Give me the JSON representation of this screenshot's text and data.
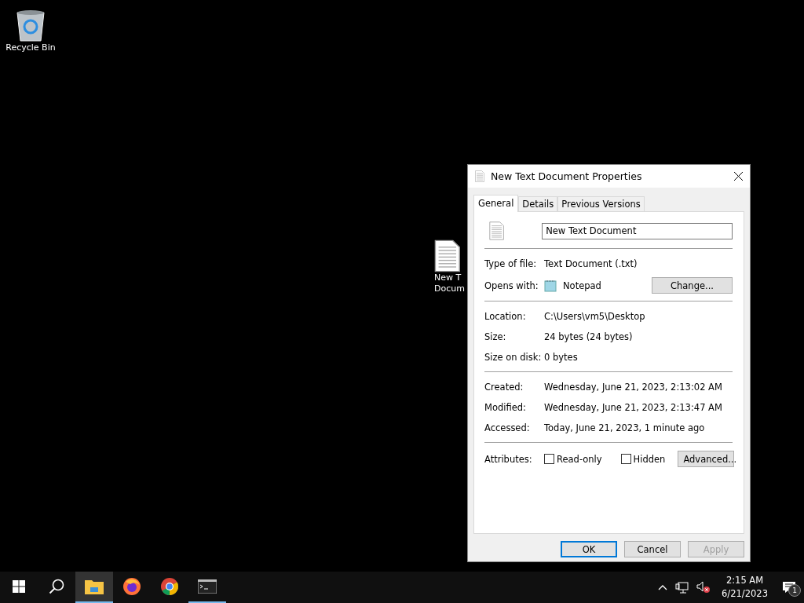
{
  "desktop_icons": [
    {
      "kind": "recycle-bin",
      "label_lines": [
        "Recycle Bin"
      ]
    },
    {
      "kind": "text-file",
      "label_lines": [
        "New T",
        "Docum"
      ]
    }
  ],
  "dialog": {
    "title": "New Text Document Properties",
    "tabs": [
      {
        "label": "General",
        "selected": true
      },
      {
        "label": "Details",
        "selected": false
      },
      {
        "label": "Previous Versions",
        "selected": false
      }
    ],
    "file_name": "New Text Document",
    "sections": [
      [
        {
          "label": "Type of file:",
          "value": "Text Document (.txt)"
        },
        {
          "label": "Opens with:",
          "value": "Notepad",
          "app_icon": true,
          "button": "Change..."
        }
      ],
      [
        {
          "label": "Location:",
          "value": "C:\\Users\\vm5\\Desktop"
        },
        {
          "label": "Size:",
          "value": "24 bytes (24 bytes)"
        },
        {
          "label": "Size on disk:",
          "value": "0 bytes"
        }
      ],
      [
        {
          "label": "Created:",
          "value": "Wednesday, June 21, 2023, 2:13:02 AM"
        },
        {
          "label": "Modified:",
          "value": "Wednesday, June 21, 2023, 2:13:47 AM"
        },
        {
          "label": "Accessed:",
          "value": "Today, June 21, 2023, 1 minute ago"
        }
      ]
    ],
    "attributes": {
      "label": "Attributes:",
      "checkboxes": [
        {
          "label": "Read-only",
          "checked": false
        },
        {
          "label": "Hidden",
          "checked": false
        }
      ],
      "button": "Advanced..."
    },
    "buttons": [
      {
        "label": "OK",
        "default": true,
        "disabled": false
      },
      {
        "label": "Cancel",
        "default": false,
        "disabled": false
      },
      {
        "label": "Apply",
        "default": false,
        "disabled": true
      }
    ]
  },
  "taskbar": {
    "items": [
      {
        "kind": "start",
        "active": false,
        "open": false
      },
      {
        "kind": "search",
        "active": false,
        "open": false
      },
      {
        "kind": "explorer",
        "active": true,
        "open": true
      },
      {
        "kind": "firefox",
        "active": false,
        "open": false
      },
      {
        "kind": "chrome",
        "active": false,
        "open": false
      },
      {
        "kind": "terminal",
        "active": false,
        "open": true
      }
    ],
    "time": "2:15 AM",
    "date": "6/21/2023",
    "notification_count": "1"
  }
}
